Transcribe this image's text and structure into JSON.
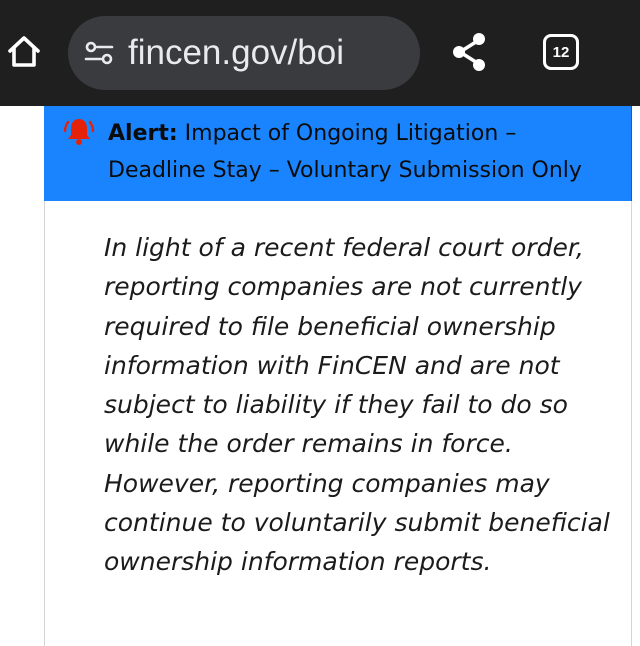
{
  "browser": {
    "url": "fincen.gov/boi",
    "tab_count": "12"
  },
  "alert": {
    "label": "Alert:",
    "message": " Impact of Ongoing Litigation – Deadline Stay – Voluntary Submission Only"
  },
  "notice": {
    "text": "In light of a recent federal court order, reporting companies are not currently required to file beneficial ownership information with FinCEN and are not subject to liability if they fail to do so while the order remains in force. However, reporting companies may continue to voluntarily submit beneficial ownership information reports."
  },
  "icons": {
    "home": "home-icon",
    "site_settings": "tune-icon",
    "share": "share-icon",
    "tabs": "tab-switcher-icon",
    "alert": "bell-icon"
  },
  "colors": {
    "browser_bar": "#1f1f1f",
    "url_pill": "#3a3b3e",
    "alert_background": "#1a84ff",
    "bell": "#e52207"
  }
}
